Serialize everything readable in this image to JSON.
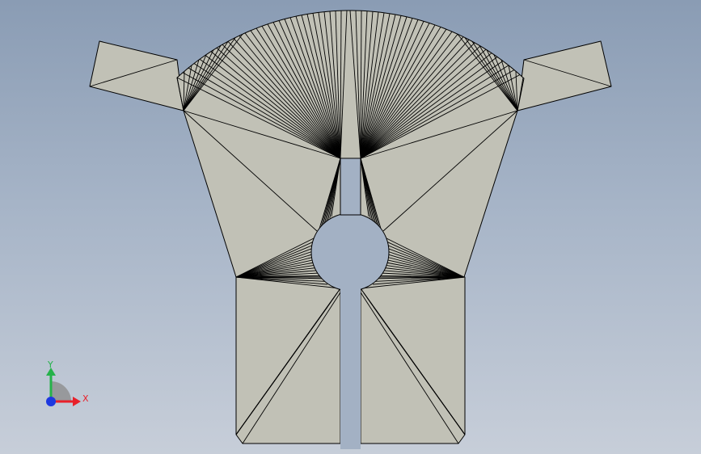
{
  "viewport": {
    "background_top": "#8a9cb4",
    "background_bottom": "#c7ced9"
  },
  "part": {
    "face_color": "#c1c1b6",
    "edge_color": "#000000",
    "hole_color": "#a3b1c4"
  },
  "triad": {
    "x_label": "X",
    "y_label": "Y",
    "x_color": "#e8202a",
    "y_color": "#25b24a",
    "z_color": "#1d38e0"
  }
}
